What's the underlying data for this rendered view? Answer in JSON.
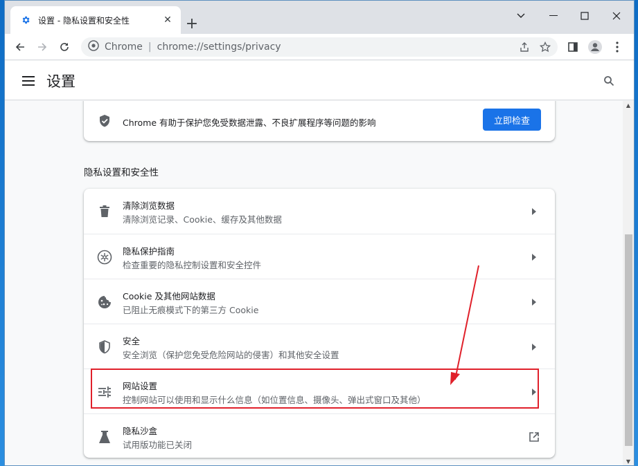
{
  "window": {
    "tab_title": "设置 - 隐私设置和安全性",
    "tab_favicon": "gear-icon",
    "controls": [
      "minimize",
      "maximize",
      "close"
    ]
  },
  "toolbar": {
    "site_name": "Chrome",
    "separator": "|",
    "url": "chrome://settings/privacy"
  },
  "header": {
    "title": "设置"
  },
  "safety_check": {
    "text": "Chrome 有助于保护您免受数据泄露、不良扩展程序等问题的影响",
    "button_label": "立即检查"
  },
  "privacy_section": {
    "title": "隐私设置和安全性",
    "items": [
      {
        "icon": "trash-icon",
        "title": "清除浏览数据",
        "subtitle": "清除浏览记录、Cookie、缓存及其他数据",
        "action": "chevron-right-icon"
      },
      {
        "icon": "privacy-guide-icon",
        "title": "隐私保护指南",
        "subtitle": "检查重要的隐私控制设置和安全控件",
        "action": "chevron-right-icon"
      },
      {
        "icon": "cookie-icon",
        "title": "Cookie 及其他网站数据",
        "subtitle": "已阻止无痕模式下的第三方 Cookie",
        "action": "chevron-right-icon"
      },
      {
        "icon": "shield-icon",
        "title": "安全",
        "subtitle": "安全浏览（保护您免受危险网站的侵害）和其他安全设置",
        "action": "chevron-right-icon"
      },
      {
        "icon": "sliders-icon",
        "title": "网站设置",
        "subtitle": "控制网站可以使用和显示什么信息（如位置信息、摄像头、弹出式窗口及其他）",
        "action": "chevron-right-icon"
      },
      {
        "icon": "flask-icon",
        "title": "隐私沙盒",
        "subtitle": "试用版功能已关闭",
        "action": "external-link-icon"
      }
    ]
  },
  "colors": {
    "accent": "#1a73e8",
    "annotation": "#e0202a"
  }
}
